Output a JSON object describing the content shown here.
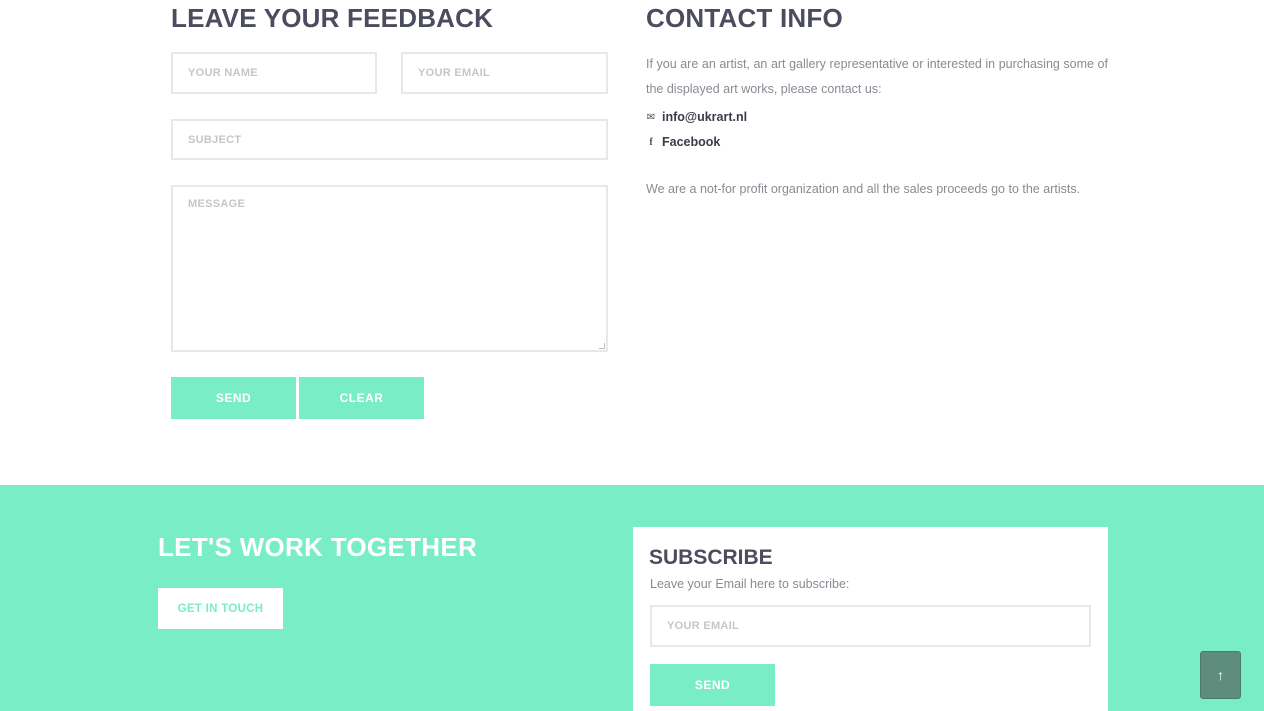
{
  "feedback": {
    "title": "LEAVE YOUR FEEDBACK",
    "name_placeholder": "YOUR NAME",
    "email_placeholder": "YOUR EMAIL",
    "subject_placeholder": "SUBJECT",
    "message_placeholder": "MESSAGE",
    "send_label": "SEND",
    "clear_label": "CLEAR"
  },
  "contact": {
    "title": "CONTACT INFO",
    "intro": "If you are an artist, an art gallery representative or interested in purchasing some of the displayed art works, please contact us:",
    "email": "info@ukrart.nl",
    "email_icon": "envelope-icon",
    "facebook": "Facebook",
    "facebook_icon": "facebook-icon",
    "note": "We are a not-for profit organization and all the sales proceeds go to the artists."
  },
  "cta": {
    "title": "LET'S WORK TOGETHER",
    "button_label": "GET IN TOUCH"
  },
  "subscribe": {
    "title": "SUBSCRIBE",
    "text": "Leave your Email here to subscribe:",
    "email_placeholder": "YOUR EMAIL",
    "send_label": "SEND"
  },
  "scroll_top": {
    "icon": "arrow-up-icon",
    "glyph": "↑"
  },
  "colors": {
    "accent": "#79edc5",
    "heading": "#4b4c5e",
    "scroll_top_bg": "#5e8d7e"
  }
}
